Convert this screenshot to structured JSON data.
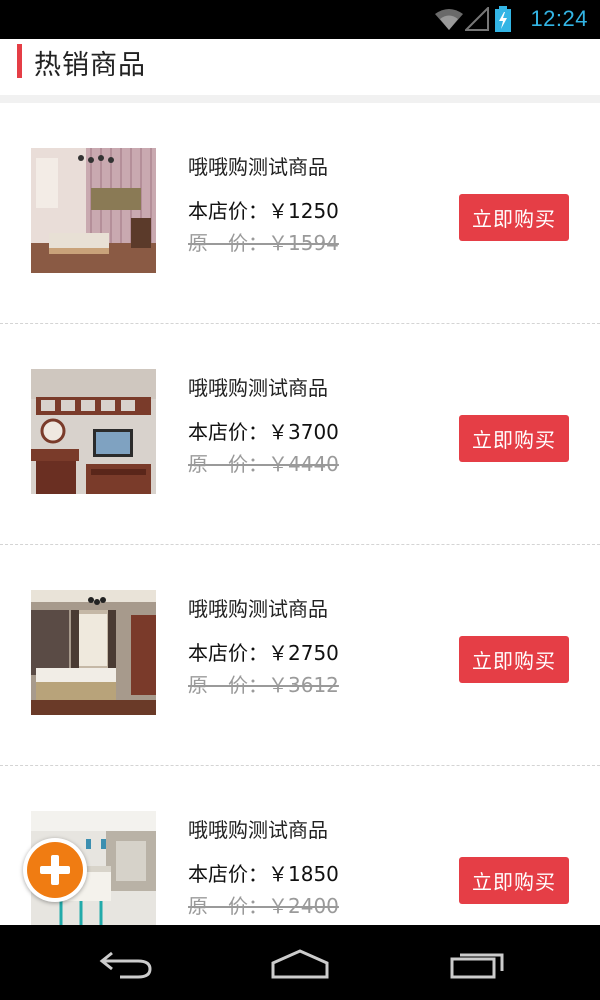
{
  "status_bar": {
    "time": "12:24",
    "icons": [
      "wifi-icon",
      "signal-icon",
      "battery-charging-icon"
    ]
  },
  "header": {
    "title": "热销商品"
  },
  "products": [
    {
      "name": "哦哦购测试商品",
      "price_label": "本店价：￥1250",
      "original_price_label": "原　价：￥1594",
      "buy_label": "立即购买"
    },
    {
      "name": "哦哦购测试商品",
      "price_label": "本店价：￥3700",
      "original_price_label": "原　价：￥4440",
      "buy_label": "立即购买"
    },
    {
      "name": "哦哦购测试商品",
      "price_label": "本店价：￥2750",
      "original_price_label": "原　价：￥3612",
      "buy_label": "立即购买"
    },
    {
      "name": "哦哦购测试商品",
      "price_label": "本店价：￥1850",
      "original_price_label": "原　价：￥2400",
      "buy_label": "立即购买"
    }
  ],
  "fab": {
    "icon": "plus-icon",
    "color": "#f07c12"
  },
  "nav_bar": {
    "icons": [
      "back-icon",
      "home-icon",
      "recent-apps-icon"
    ]
  },
  "colors": {
    "accent": "#e53e46",
    "status_time": "#33b5e5"
  }
}
